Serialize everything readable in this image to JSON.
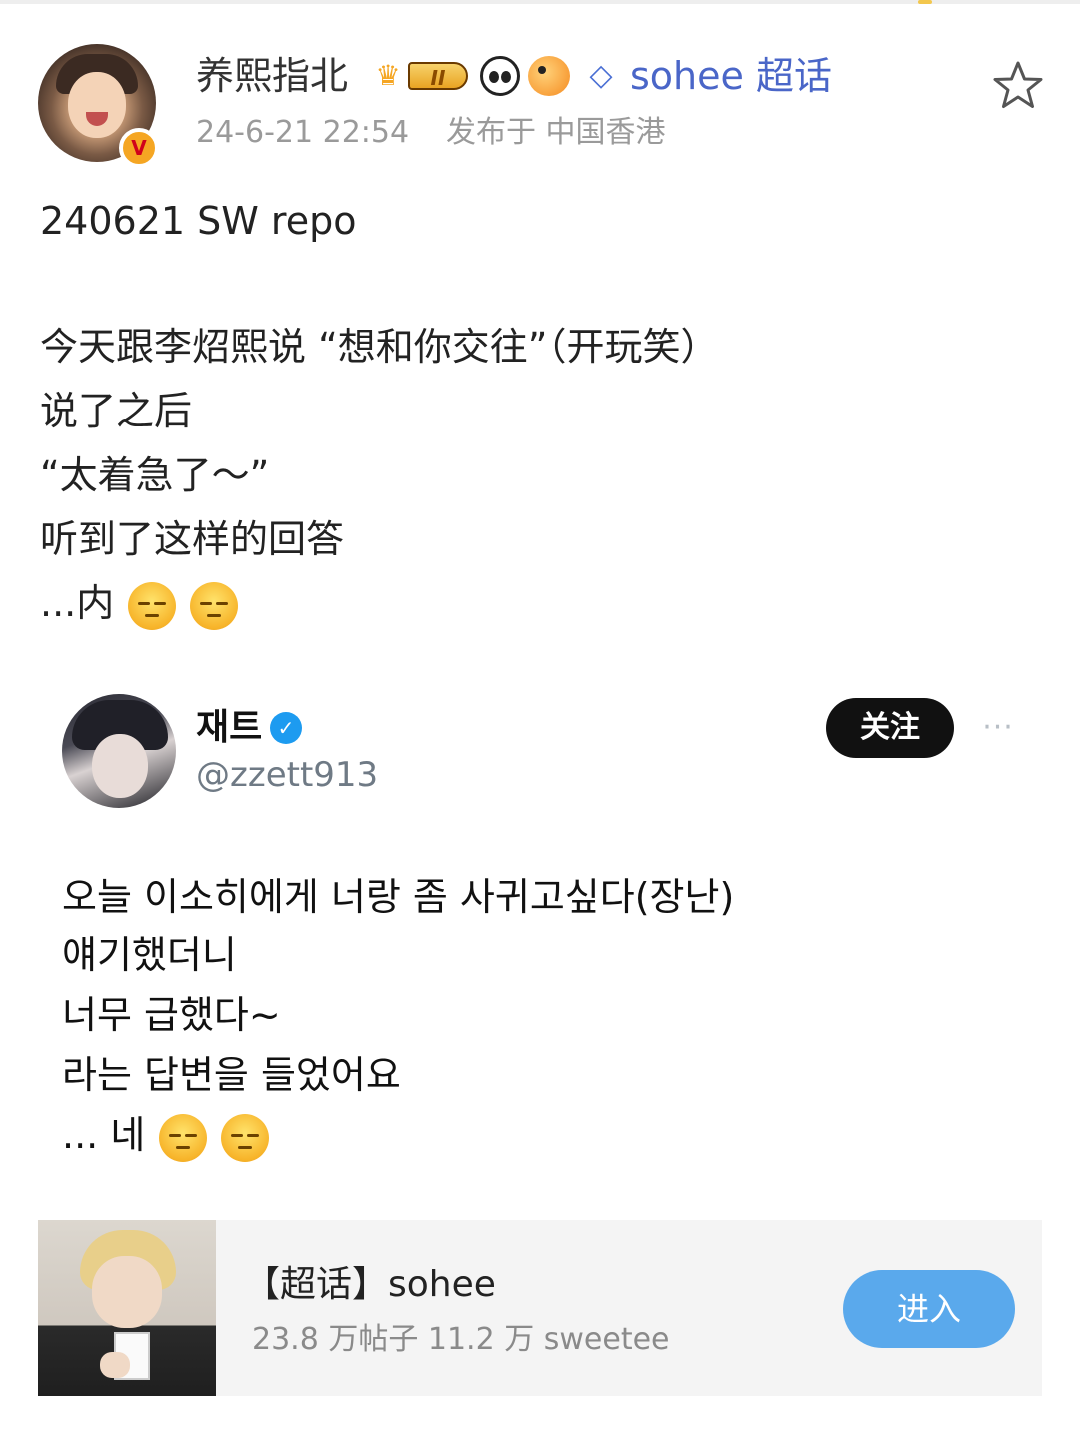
{
  "header": {
    "username": "养熙指北",
    "level_badge": "II",
    "supertopic_link": "sohee 超话",
    "timestamp": "24-6-21 22:54",
    "posted_from": "发布于 中国香港",
    "verified_badge": "V"
  },
  "post": {
    "lines": [
      "240621 SW repo",
      "今天跟李炤熙说 “想和你交往”（开玩笑）",
      "说了之后",
      "“太着急了～”",
      "听到了这样的回答",
      "...内"
    ]
  },
  "tweet": {
    "name": "재트",
    "handle": "@zzett913",
    "follow_label": "关注",
    "more_label": "···",
    "lines": [
      "오늘 이소히에게 너랑 좀 사귀고싶다(장난)",
      "얘기했더니",
      "너무 급했다~",
      "라는 답변을 들었어요",
      "... 네"
    ]
  },
  "topic_card": {
    "title": "【超话】sohee",
    "stats": "23.8 万帖子 11.2 万 sweetee",
    "enter_label": "进入"
  },
  "colors": {
    "accent_link": "#4a66c8",
    "enter_button": "#5aa9ec",
    "verified": "#1d9bf0"
  },
  "icons": [
    "crown-icon",
    "panda-icon",
    "fish-icon",
    "diamond-icon",
    "star-icon",
    "verified-icon",
    "more-icon",
    "pensive-face-emoji"
  ]
}
